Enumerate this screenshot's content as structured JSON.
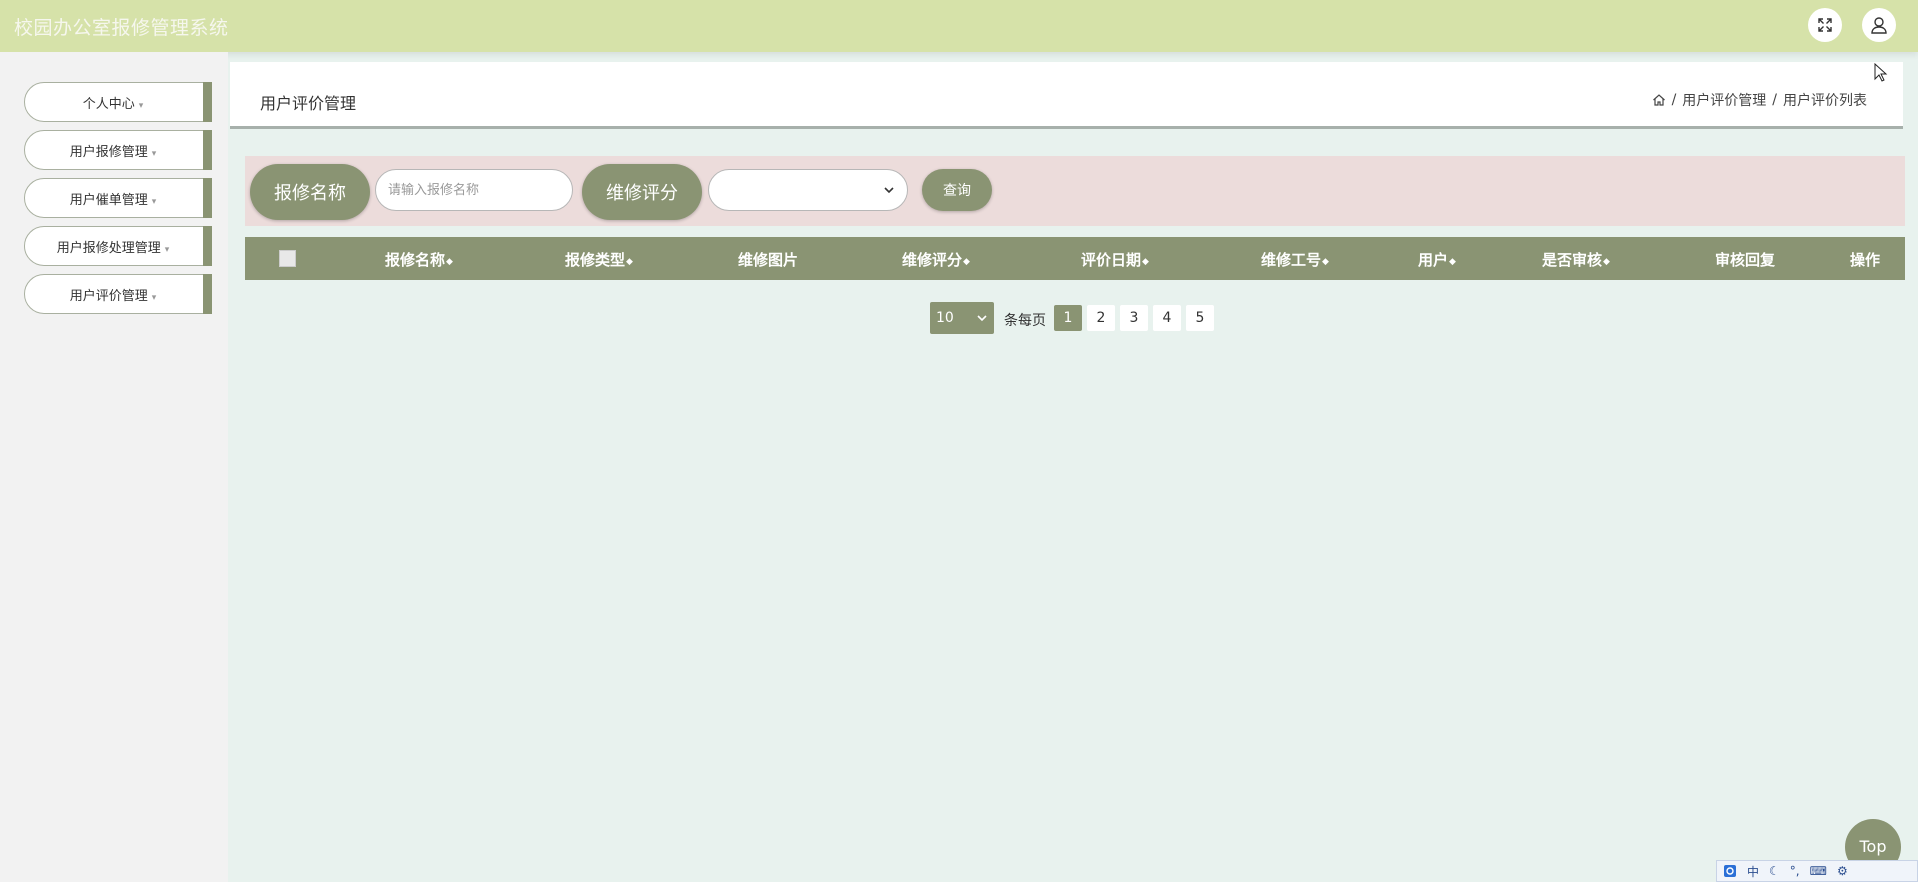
{
  "header": {
    "app_title": "校园办公室报修管理系统"
  },
  "sidebar": {
    "items": [
      {
        "label": "个人中心"
      },
      {
        "label": "用户报修管理"
      },
      {
        "label": "用户催单管理"
      },
      {
        "label": "用户报修处理管理"
      },
      {
        "label": "用户评价管理"
      }
    ]
  },
  "page": {
    "title": "用户评价管理",
    "breadcrumb": [
      "用户评价管理",
      "用户评价列表"
    ]
  },
  "search": {
    "name_label": "报修名称",
    "name_placeholder": "请输入报修名称",
    "score_label": "维修评分",
    "score_value": "",
    "query_button": "查询"
  },
  "table": {
    "columns": [
      "报修名称",
      "报修类型",
      "维修图片",
      "维修评分",
      "评价日期",
      "维修工号",
      "用户",
      "是否审核",
      "审核回复",
      "操作"
    ],
    "rows": []
  },
  "pagination": {
    "page_size": "10",
    "per_page_label": "条每页",
    "pages": [
      "1",
      "2",
      "3",
      "4",
      "5"
    ],
    "current": "1"
  },
  "back_to_top": "Top",
  "ime": {
    "mode": "中"
  },
  "colors": {
    "accent": "#8a9473",
    "topbar": "#d6e2a9",
    "background": "#e8f2ee",
    "search_bg": "#ecdcdb"
  }
}
